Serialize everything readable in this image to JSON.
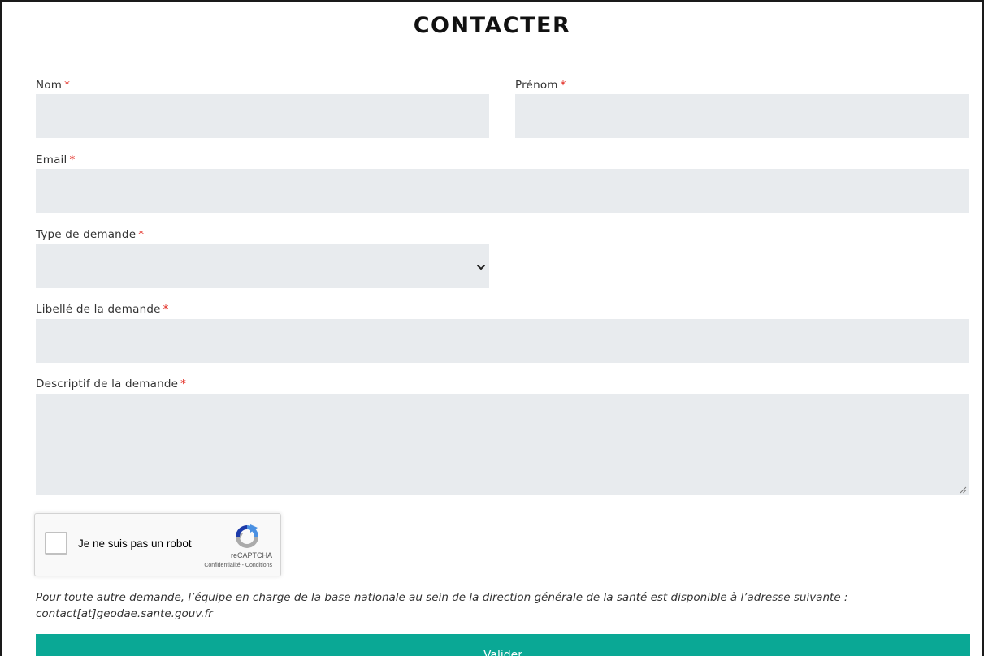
{
  "page": {
    "title": "CONTACTER"
  },
  "form": {
    "required_marker": "*",
    "fields": {
      "nom": {
        "label": "Nom",
        "value": "",
        "placeholder": ""
      },
      "prenom": {
        "label": "Prénom",
        "value": "",
        "placeholder": ""
      },
      "email": {
        "label": "Email",
        "value": "",
        "placeholder": ""
      },
      "type": {
        "label": "Type de demande",
        "selected": ""
      },
      "libelle": {
        "label": "Libellé de la demande",
        "value": "",
        "placeholder": ""
      },
      "descriptif": {
        "label": "Descriptif de la demande",
        "value": "",
        "placeholder": ""
      }
    },
    "recaptcha": {
      "label": "Je ne suis pas un robot",
      "brand": "reCAPTCHA",
      "privacy": "Confidentialité",
      "separator": " - ",
      "terms": "Conditions",
      "checked": false
    },
    "note_line1": "Pour toute autre demande, l’équipe en charge de la base nationale au sein de la direction générale de la santé est disponible à l’adresse suivante :",
    "note_line2": "contact[at]geodae.sante.gouv.fr",
    "submit_label": "Valider"
  },
  "colors": {
    "field_bg": "#e8ebee",
    "required": "#e2231a",
    "submit_bg": "#0aa895",
    "recaptcha_blue": "#4a90e2",
    "recaptcha_dark_blue": "#1c3aa9",
    "recaptcha_grey": "#ababab"
  },
  "icons": {
    "select": "chevron-down-icon",
    "resize": "resize-grip-icon",
    "recaptcha": "recaptcha-logo-icon"
  }
}
